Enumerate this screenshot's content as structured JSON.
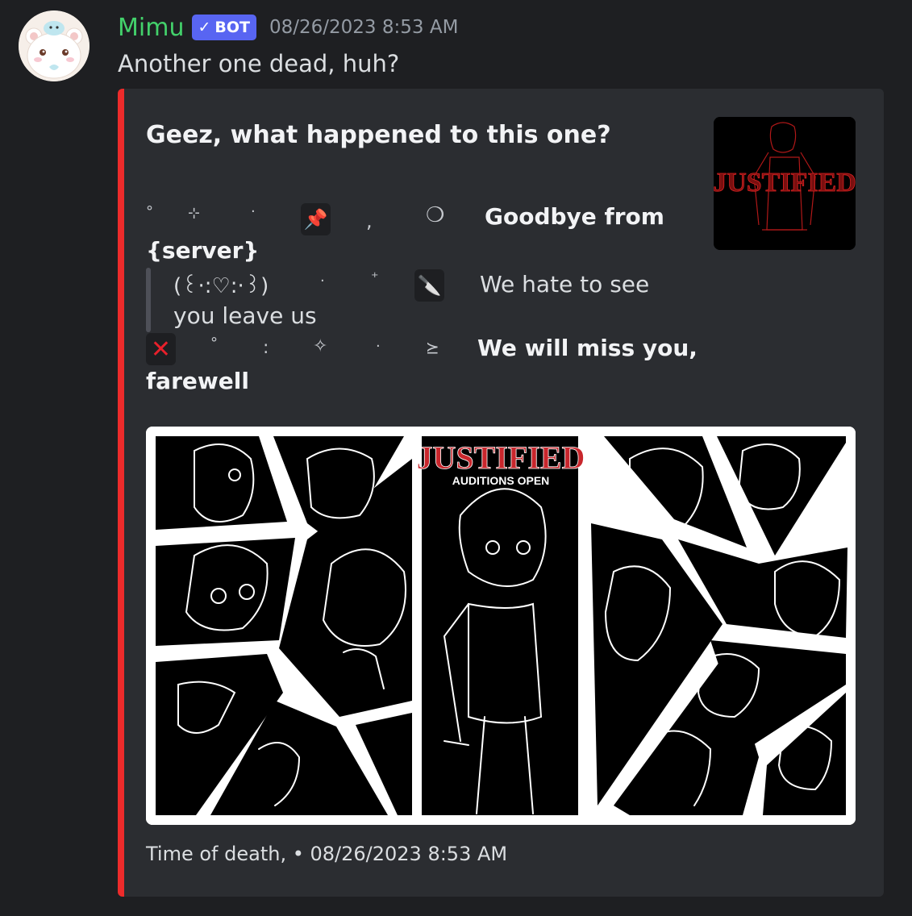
{
  "author": {
    "name": "Mimu",
    "bot_tag": "BOT",
    "check_icon": "check-icon",
    "timestamp": "08/26/2023 8:53 AM"
  },
  "message": {
    "text": "Another one dead, huh?"
  },
  "embed": {
    "accent_color": "#ed2b2b",
    "title": "Geez, what happened to this one?",
    "line1": {
      "deco1": "°",
      "deco2": "⊹",
      "deco3": "·",
      "emoji": "pushpin-icon",
      "deco4": ",",
      "deco5": "❍",
      "bold_text": "Goodbye from"
    },
    "line2": {
      "bold_text": "{server}"
    },
    "quote": {
      "kaomoji": "(꒰·:♡:·꒱)",
      "deco1": "·",
      "deco2": "⁺",
      "emoji": "knife-icon",
      "text1": "We hate to see",
      "text2": "you leave us"
    },
    "line3": {
      "emoji": "cross-mark-icon",
      "deco1": "°",
      "deco2": ":",
      "deco3": "✧",
      "deco4": "·",
      "deco5": "⪰",
      "bold_text": "We will miss you,"
    },
    "line4": {
      "bold_text": "farewell"
    },
    "thumbnail_text": "JUSTIFIED",
    "image": {
      "title": "JUSTIFIED",
      "subtitle": "AUDITIONS OPEN"
    },
    "footer": "Time of death, • 08/26/2023 8:53 AM"
  }
}
